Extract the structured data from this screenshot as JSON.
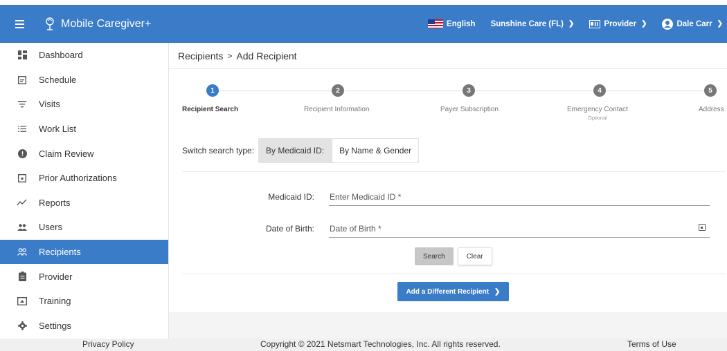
{
  "header": {
    "app_title": "Mobile Caregiver+",
    "language": "English",
    "agency": "Sunshine Care (FL)",
    "role": "Provider",
    "user": "Dale Carr"
  },
  "sidebar": {
    "items": [
      {
        "label": "Dashboard",
        "icon": "dashboard-icon"
      },
      {
        "label": "Schedule",
        "icon": "calendar-icon"
      },
      {
        "label": "Visits",
        "icon": "filter-icon"
      },
      {
        "label": "Work List",
        "icon": "list-icon"
      },
      {
        "label": "Claim Review",
        "icon": "alert-icon"
      },
      {
        "label": "Prior Authorizations",
        "icon": "calendar-event-icon"
      },
      {
        "label": "Reports",
        "icon": "trend-icon"
      },
      {
        "label": "Users",
        "icon": "users-icon"
      },
      {
        "label": "Recipients",
        "icon": "recipients-icon",
        "active": true
      },
      {
        "label": "Provider",
        "icon": "clipboard-icon"
      },
      {
        "label": "Training",
        "icon": "training-icon"
      },
      {
        "label": "Settings",
        "icon": "gear-icon"
      }
    ]
  },
  "breadcrumb": {
    "parent": "Recipients",
    "separator": ">",
    "current": "Add Recipient"
  },
  "stepper": {
    "steps": [
      {
        "number": "1",
        "label": "Recipient Search",
        "active": true
      },
      {
        "number": "2",
        "label": "Recipient Information"
      },
      {
        "number": "3",
        "label": "Payer Subscription"
      },
      {
        "number": "4",
        "label": "Emergency Contact",
        "sub": "Optional"
      },
      {
        "number": "5",
        "label": "Address"
      }
    ]
  },
  "search_type": {
    "label": "Switch search type:",
    "options": [
      "By Medicaid ID:",
      "By Name & Gender"
    ],
    "selected": "By Medicaid ID:"
  },
  "form": {
    "medicaid_label": "Medicaid ID:",
    "medicaid_placeholder": "Enter Medicaid ID *",
    "dob_label": "Date of Birth:",
    "dob_placeholder": "Date of Birth *"
  },
  "buttons": {
    "search": "Search",
    "clear": "Clear",
    "add_different": "Add a Different Recipient"
  },
  "footer": {
    "privacy": "Privacy Policy",
    "copyright": "Copyright © 2021 Netsmart Technologies, Inc. All rights reserved.",
    "terms": "Terms of Use"
  },
  "colors": {
    "primary": "#3b7cc8",
    "step_inactive": "#777777"
  }
}
